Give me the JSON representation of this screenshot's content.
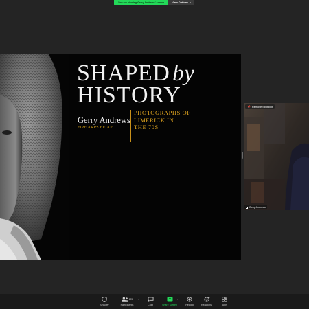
{
  "share_banner": {
    "notice": "You are viewing Gerry Andrews' screen",
    "view_options_label": "View Options",
    "accent_color": "#23d959"
  },
  "slide": {
    "title_word1": "SHAPED",
    "title_word2": "by",
    "title_line2": "HISTORY",
    "author_name": "Gerry Andrews",
    "author_credentials": "FIPF ARPS EFIAP",
    "subtitle_lines": [
      "PHOTOGRAPHS OF",
      "LIMERICK IN",
      "THE 70S"
    ],
    "accent_color": "#e0a41f"
  },
  "video": {
    "spotlight_label": "Remove Spotlight",
    "participant_name": "Gerry Andrews"
  },
  "toolbar": {
    "security_label": "Security",
    "participants_label": "Participants",
    "participants_count": "125",
    "chat_label": "Chat",
    "share_screen_label": "Share Screen",
    "record_label": "Record",
    "reactions_label": "Reactions",
    "apps_label": "Apps"
  }
}
